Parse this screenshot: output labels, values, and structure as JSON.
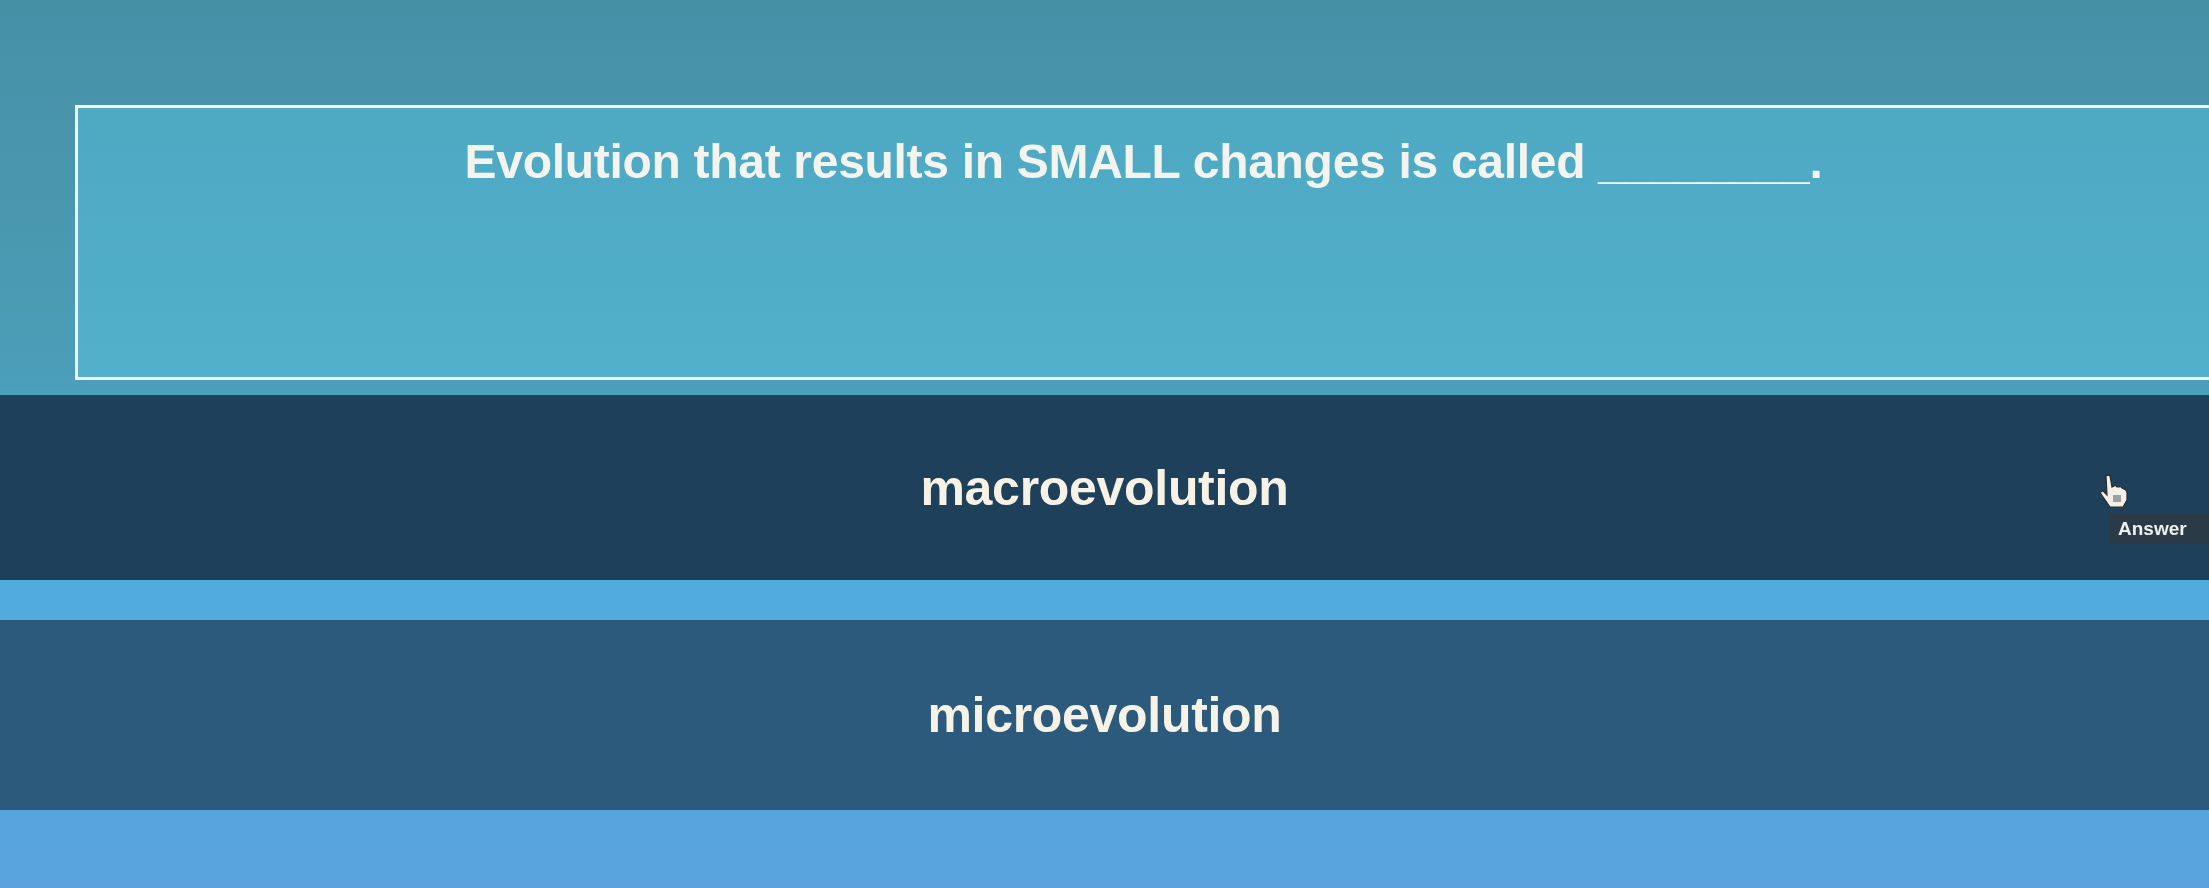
{
  "question": {
    "text": "Evolution that results in SMALL changes is called ________."
  },
  "options": [
    {
      "label": "macroevolution",
      "hovered": true
    },
    {
      "label": "microevolution",
      "hovered": false
    }
  ],
  "tooltip": {
    "text": "Answer"
  }
}
